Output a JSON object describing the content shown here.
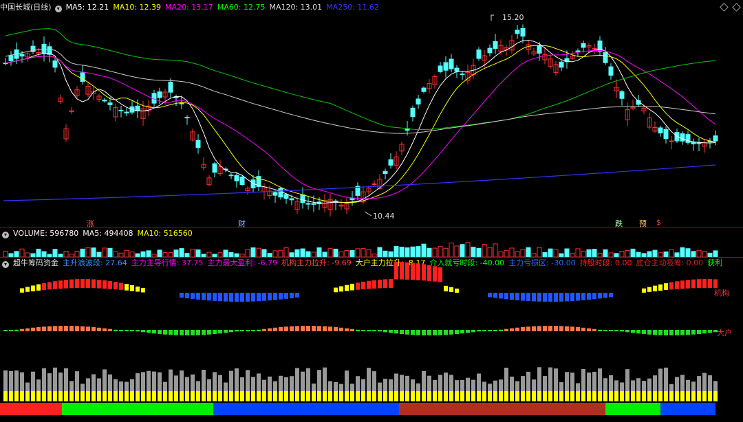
{
  "main": {
    "title": "中国长城(日线)",
    "ma": [
      {
        "label": "MA5: 12.21",
        "color": "#ffffff"
      },
      {
        "label": "MA10: 12.39",
        "color": "#ffff00"
      },
      {
        "label": "MA20: 13.17",
        "color": "#ff00ff"
      },
      {
        "label": "MA60: 12.75",
        "color": "#00ff00"
      },
      {
        "label": "MA120: 13.01",
        "color": "#dddddd"
      },
      {
        "label": "MA250: 11.62",
        "color": "#3333ff"
      }
    ],
    "high_label": "15.20",
    "low_label": "10.44",
    "markers": [
      "涨",
      "财",
      "跌",
      "预",
      "$"
    ]
  },
  "volume": {
    "label": "VOLUME: 596780",
    "ma5": "MA5: 494408",
    "ma10": "MA10: 516560"
  },
  "indicator": {
    "title": "超牛筹码资金",
    "items": [
      {
        "label": "主升浪波段: 27.64",
        "color": "#3a8cff"
      },
      {
        "label": "主力主导行情: 37.75",
        "color": "#ff00ff"
      },
      {
        "label": "主力最大盈利: -6.79",
        "color": "#ff00ff"
      },
      {
        "label": "机构主力拉升: -9.69",
        "color": "#ff4444"
      },
      {
        "label": "大户主力拉升: -8.17",
        "color": "#ffff00"
      },
      {
        "label": "介入就亏时段: -40.00",
        "color": "#00ff00"
      },
      {
        "label": "主力亏损区: -30.00",
        "color": "#3366ff"
      },
      {
        "label": "持股时段: 0.00",
        "color": "#ff2222"
      },
      {
        "label": "底仓主动吸筹: 0.00",
        "color": "#cc2222"
      },
      {
        "label": "获利",
        "color": "#00ff00"
      }
    ],
    "label_jigou": "机构",
    "label_dahu": "大户"
  },
  "colors": {
    "up": "#ff3232",
    "down": "#54ffff",
    "separator": "#8b1010"
  }
}
